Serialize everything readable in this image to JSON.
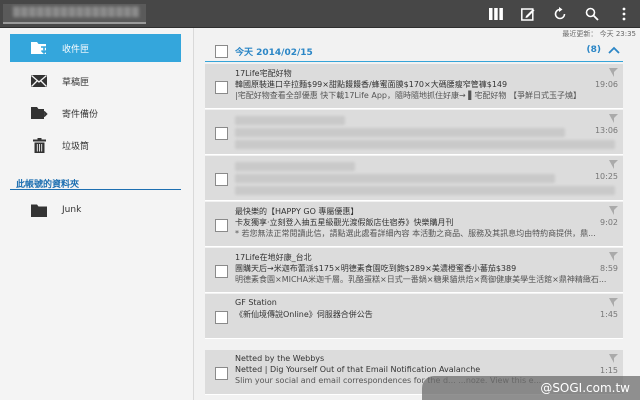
{
  "topbar": {
    "account": "▒▒▒▒▒▒▒▒▒▒▒▒▒▒▒▒",
    "actions": [
      "columns-icon",
      "compose-icon",
      "refresh-icon",
      "search-icon",
      "more-icon"
    ]
  },
  "status": {
    "last_update": "最近更新： 今天 23:35"
  },
  "sidebar": {
    "items": [
      {
        "label": "收件匣",
        "icon": "inbox-folder-icon"
      },
      {
        "label": "草稿匣",
        "icon": "envelope-icon"
      },
      {
        "label": "寄件備份",
        "icon": "sent-folder-icon"
      },
      {
        "label": "垃圾筒",
        "icon": "trash-icon"
      }
    ],
    "section_title": "此帳號的資料夾",
    "folders": [
      {
        "label": "Junk",
        "icon": "folder-icon"
      }
    ]
  },
  "list": {
    "group_label": "今天  2014/02/15",
    "group_count": "(8)",
    "mails": [
      {
        "from": "17Life宅配好物",
        "subject": "韓國原裝進口辛拉麵$99×甜點饅饅香/蜂蜜面膜$170×大碼腰瘦窄管褲$149",
        "preview": "|宅配好物查看全部優惠 快下載17Life App，隨時隨地抓住好康→ ▌宅配好物 【爭鮮日式玉子燒】",
        "time": "19:06"
      },
      {
        "from": "",
        "subject": "",
        "preview": "",
        "time": "13:06",
        "blurred": true
      },
      {
        "from": "",
        "subject": "",
        "preview": "",
        "time": "10:25",
        "blurred": true
      },
      {
        "from": "最快樂的【HAPPY GO 專屬優惠】",
        "subject": "卡友獨享‧立刻登入抽五星級觀光渡假飯店住宿券》快樂購月刊",
        "preview": "* 若您無法正常閱讀此信，請點選此處看詳細內容 本活動之商品、服務及其訊息均由特約商提供，鼎...",
        "time": "9:02"
      },
      {
        "from": "17Life在地好康_台北",
        "subject": "團購天后→米迦布蕾派$175×明德素食園吃到飽$289×美濃橙蜜香小蕃茄$389",
        "preview": "明德素食園×MICHA米迦千層。乳酪蛋糕×日式一番鍋×糖果貓烘焙×喬御健康美學生活館×鼎神精緻石...",
        "time": "8:59"
      },
      {
        "from": "GF Station",
        "subject": "《新仙境傳說Online》伺服器合併公告",
        "preview": "",
        "time": "1:45"
      },
      {
        "from": "Netted by the Webbys",
        "subject": "Netted | Dig Yourself Out of that Email Notification Avalanche",
        "preview": "Slim your social and email correspondences for the d...                         ...noze. View this e...",
        "time": "1:15"
      }
    ]
  },
  "watermark": "@SOGI.com.tw"
}
